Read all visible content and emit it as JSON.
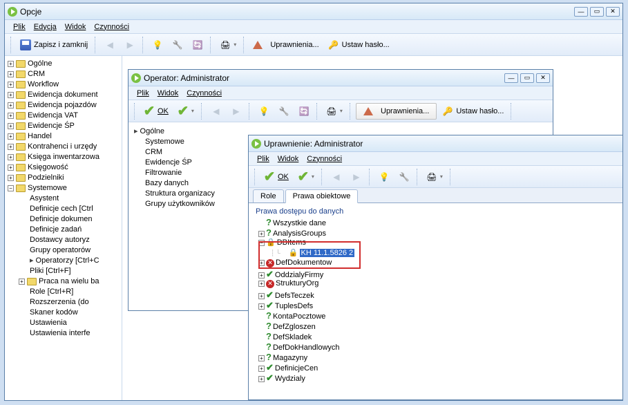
{
  "mainWindow": {
    "title": "Opcje",
    "menu": [
      "Plik",
      "Edycja",
      "Widok",
      "Czynności"
    ],
    "toolbar": {
      "saveClose": "Zapisz i zamknij",
      "perm": "Uprawnienia...",
      "setPwd": "Ustaw hasło..."
    },
    "tree": [
      {
        "t": "Ogólne"
      },
      {
        "t": "CRM"
      },
      {
        "t": "Workflow"
      },
      {
        "t": "Ewidencja dokument"
      },
      {
        "t": "Ewidencja pojazdów"
      },
      {
        "t": "Ewidencja VAT"
      },
      {
        "t": "Ewidencje ŚP"
      },
      {
        "t": "Handel"
      },
      {
        "t": "Kontrahenci i urzędy"
      },
      {
        "t": "Księga inwentarzowa"
      },
      {
        "t": "Księgowość"
      },
      {
        "t": "Podzielniki"
      },
      {
        "t": "Systemowe",
        "exp": true
      }
    ],
    "sysChildren": [
      "Asystent",
      "Definicje cech [Ctrl",
      "Definicje dokumen",
      "Definicje zadań",
      "Dostawcy autoryz",
      "Grupy operatorów",
      "Operatorzy [Ctrl+C",
      "Pliki [Ctrl+F]"
    ],
    "sysFolderChild": "Praca na wielu ba",
    "sysChildren2": [
      "Role [Ctrl+R]",
      "Rozszerzenia (do",
      "Skaner kodów",
      "Ustawienia",
      "Ustawienia interfe"
    ]
  },
  "opWindow": {
    "title": "Operator: Administrator",
    "menu": [
      "Plik",
      "Widok",
      "Czynności"
    ],
    "toolbar": {
      "ok": "OK",
      "perm": "Uprawnienia...",
      "setPwd": "Ustaw hasło..."
    },
    "list": [
      "Ogólne",
      "Systemowe",
      "CRM",
      "Ewidencje ŚP",
      "Filtrowanie",
      "Bazy danych",
      "Struktura organizacy",
      "Grupy użytkowników"
    ]
  },
  "permWindow": {
    "title": "Uprawnienie: Administrator",
    "menu": [
      "Plik",
      "Widok",
      "Czynności"
    ],
    "toolbar": {
      "ok": "OK"
    },
    "tabs": [
      "Role",
      "Prawa obiektowe"
    ],
    "group": "Prawa dostępu do danych",
    "rights": [
      {
        "k": "q",
        "t": "Wszystkie dane",
        "lv": 0,
        "e": ""
      },
      {
        "k": "q",
        "t": "AnalysisGroups",
        "lv": 0,
        "e": "+"
      },
      {
        "k": "lock",
        "t": "DBItems",
        "lv": 0,
        "e": "-"
      },
      {
        "k": "lock",
        "t": "KH 11.1.5826 2",
        "lv": 1,
        "sel": true
      },
      {
        "k": "deny",
        "t": "DefDokumentow",
        "lv": 0,
        "e": "+"
      },
      {
        "k": "ok",
        "t": "OddzialyFirmy",
        "lv": 0,
        "e": "+"
      },
      {
        "k": "deny",
        "t": "StrukturyOrg",
        "lv": 0,
        "e": "+"
      },
      {
        "k": "ok",
        "t": "DefsTeczek",
        "lv": 0,
        "e": "+"
      },
      {
        "k": "ok",
        "t": "TuplesDefs",
        "lv": 0,
        "e": "+"
      },
      {
        "k": "q",
        "t": "KontaPocztowe",
        "lv": 0
      },
      {
        "k": "q",
        "t": "DefZgloszen",
        "lv": 0
      },
      {
        "k": "q",
        "t": "DefSkladek",
        "lv": 0
      },
      {
        "k": "q",
        "t": "DefDokHandlowych",
        "lv": 0
      },
      {
        "k": "q",
        "t": "Magazyny",
        "lv": 0,
        "e": "+"
      },
      {
        "k": "ok",
        "t": "DefinicjeCen",
        "lv": 0,
        "e": "+"
      },
      {
        "k": "ok",
        "t": "Wydzialy",
        "lv": 0,
        "e": "+"
      }
    ]
  }
}
